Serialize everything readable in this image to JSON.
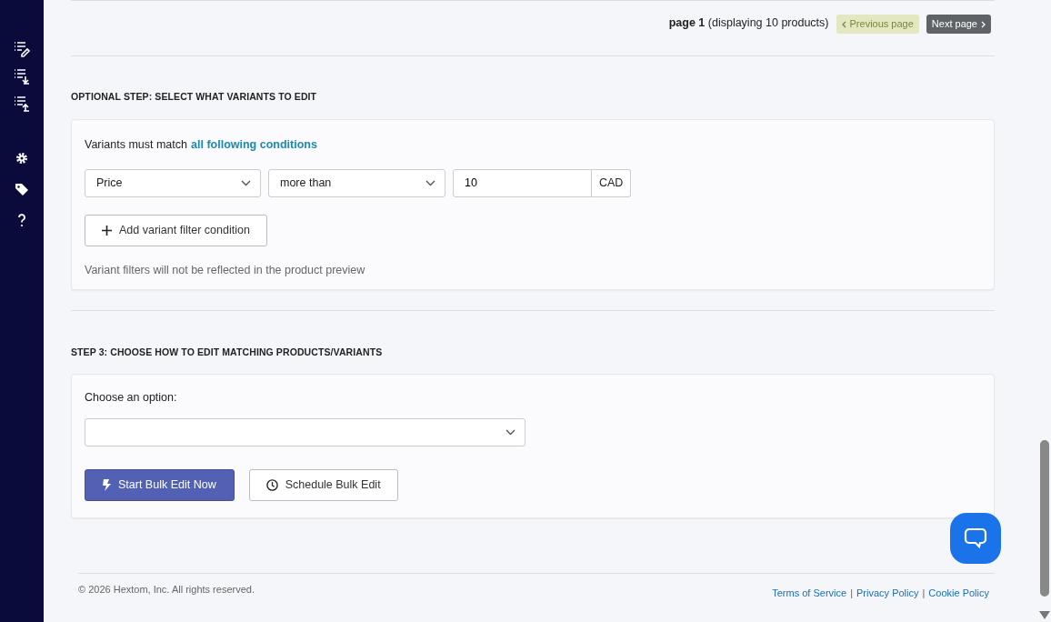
{
  "pagination": {
    "info": "**page 1** (displaying 10 products)",
    "buttons": [
      {
        "label": "Previous page",
        "kind": "prev",
        "disabled": true
      },
      {
        "label": "Next page",
        "kind": "next",
        "disabled": false
      }
    ]
  },
  "variant_step": {
    "title": "OPTIONAL STEP: SELECT WHAT VARIANTS TO EDIT",
    "intro": "Variants must match",
    "intro_link": "all following conditions",
    "conditions": [
      {
        "field": "Price",
        "operator": "more than",
        "value": "10",
        "unit": "CAD"
      }
    ],
    "add_button": "Add variant filter condition",
    "note": "Variant filters will not be reflected in the product preview"
  },
  "step3": {
    "title": "STEP 3: CHOOSE HOW TO EDIT MATCHING PRODUCTS/VARIANTS",
    "label": "Choose an option:",
    "buttons": [
      {
        "label": "Start Bulk Edit Now",
        "kind": "primary"
      },
      {
        "label": "Schedule Bulk Edit",
        "kind": "outline"
      }
    ]
  },
  "footer": {
    "copyright": "© 2026 Hextom, Inc. All rights reserved.",
    "links": [
      "Terms of Service",
      "Privacy Policy",
      "Cookie Policy"
    ],
    "separators": [
      "|",
      "|"
    ]
  }
}
